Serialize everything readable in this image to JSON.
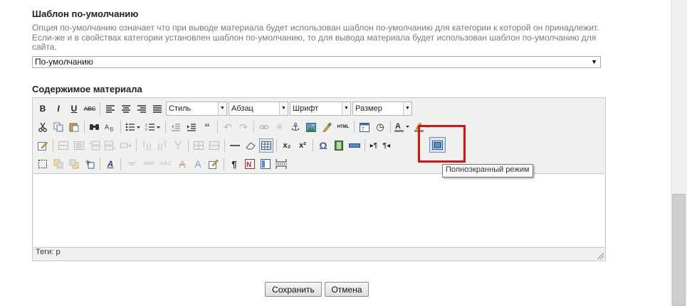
{
  "template_section": {
    "title": "Шаблон по-умолчанию",
    "description": "Опция по-умолчанию означает что при выводе материала будет использован шаблон по-умолчанию для категории к которой он принадлежит. Если-же и в свойствах категории установлен шаблон по-умолчанию, то для вывода материала будет использован шаблон по-умолчанию для сайта.",
    "select_value": "По-умолчанию"
  },
  "content_section": {
    "title": "Содержимое материала"
  },
  "toolbar": {
    "style_dropdown": "Стиль",
    "format_dropdown": "Абзац",
    "font_dropdown": "Шрифт",
    "size_dropdown": "Размер",
    "bold": "B",
    "italic": "I",
    "underline": "U",
    "strike": "ABC",
    "html_label": "HTML",
    "subscript": "x₂",
    "superscript": "x²",
    "omega": "Ω",
    "pilcrow": "¶"
  },
  "editor": {
    "status_text": "Теги: p",
    "tooltip": "Полноэкранный режим"
  },
  "buttons": {
    "save": "Сохранить",
    "cancel": "Отмена"
  },
  "colors": {
    "highlight": "#e01010",
    "toolbar_bg": "#f0f0ee"
  }
}
